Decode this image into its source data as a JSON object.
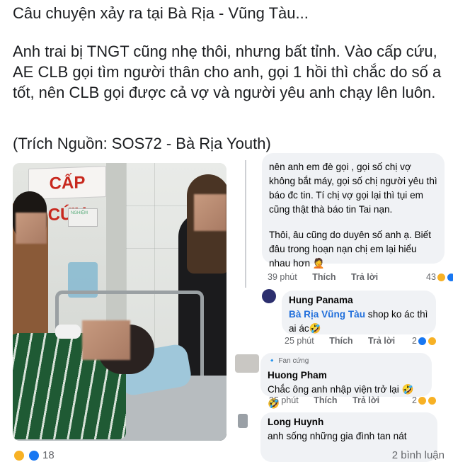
{
  "post": {
    "line1": "Câu chuyện xảy ra tại Bà Rịa - Vũng Tàu...",
    "line2": "Anh trai bị TNGT cũng nhẹ thôi, nhưng bất tỉnh. Vào cấp cứu, AE CLB gọi tìm người thân cho anh, gọi 1 hồi thì chắc do số a tốt, nên CLB gọi được cả vợ và người yêu anh chạy lên luôn.",
    "line3": "(Trích Nguồn: SOS72 - Bà Rịa Youth)"
  },
  "photo": {
    "sign_text": "CẤP CỨU",
    "small_sign_text": "NGHIỆM"
  },
  "comments": [
    {
      "text_part1": "nên anh em đè gọi , gọi số chị vợ không bắt máy, gọi số chị người yêu thì báo đc tin. Tí chị vợ gọi lại thì tụi em cũng thật thà báo tin Tai nạn.",
      "text_part2": "Thôi, âu cũng do duyên số anh ạ. Biết đâu trong hoạn nạn chị em lại hiểu nhau hơn 🤦",
      "time": "39 phút",
      "like": "Thích",
      "reply": "Trả lời",
      "reactions": "43"
    },
    {
      "name": "Hung Panama",
      "tag": "Bà Rịa Vũng Tàu",
      "text": " shop ko ác thì ai ác🤣",
      "time": "25 phút",
      "like": "Thích",
      "reply": "Trả lời",
      "reactions": "2"
    },
    {
      "badge": "Fan cứng",
      "name": "Huong Pham",
      "text": "Chắc ông anh nhập viện trở lại 🤣🤣",
      "time": "35 phút",
      "like": "Thích",
      "reply": "Trả lời",
      "reactions": "2"
    },
    {
      "name": "Long Huynh",
      "text": "anh sống những gia đình tan nát"
    }
  ],
  "footer": {
    "reactions": "18",
    "comments": "2 bình luận"
  },
  "colors": {
    "link": "#216fdb",
    "secondary_text": "#65676b",
    "bubble": "#f0f2f5"
  }
}
